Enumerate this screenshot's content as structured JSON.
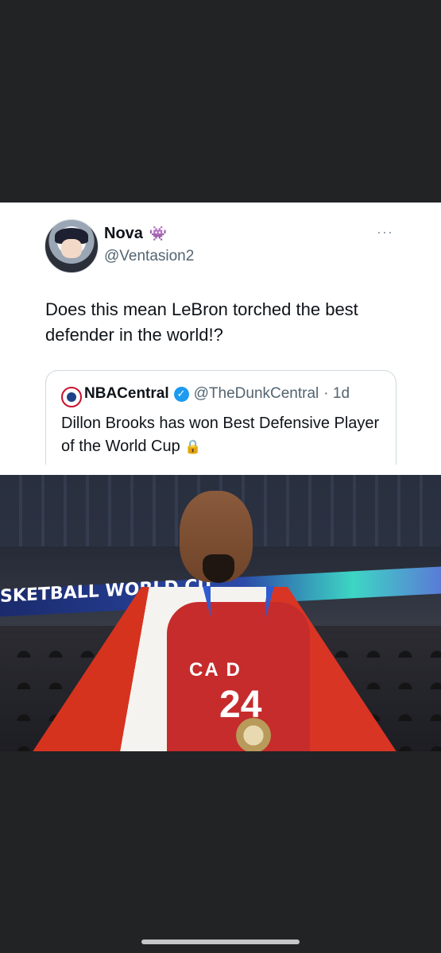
{
  "tweet": {
    "author_name": "Nova",
    "author_emoji": "👾",
    "author_handle": "@Ventasion2",
    "more_icon": "···",
    "text": "Does this mean LeBron torched the best defender in the world!?"
  },
  "quote": {
    "name": "NBACentral",
    "verified_icon": "✓",
    "handle": "@TheDunkCentral",
    "time": "· 1d",
    "text": "Dillon Brooks has won Best Defensive Player of the World Cup",
    "lock_icon": "🔒"
  },
  "photo": {
    "banner_text": "SKETBALL WORLD CU",
    "jersey_text": "CA  D",
    "jersey_number": "24"
  },
  "colors": {
    "verified": "#1d9bf0",
    "background": "#222325"
  }
}
